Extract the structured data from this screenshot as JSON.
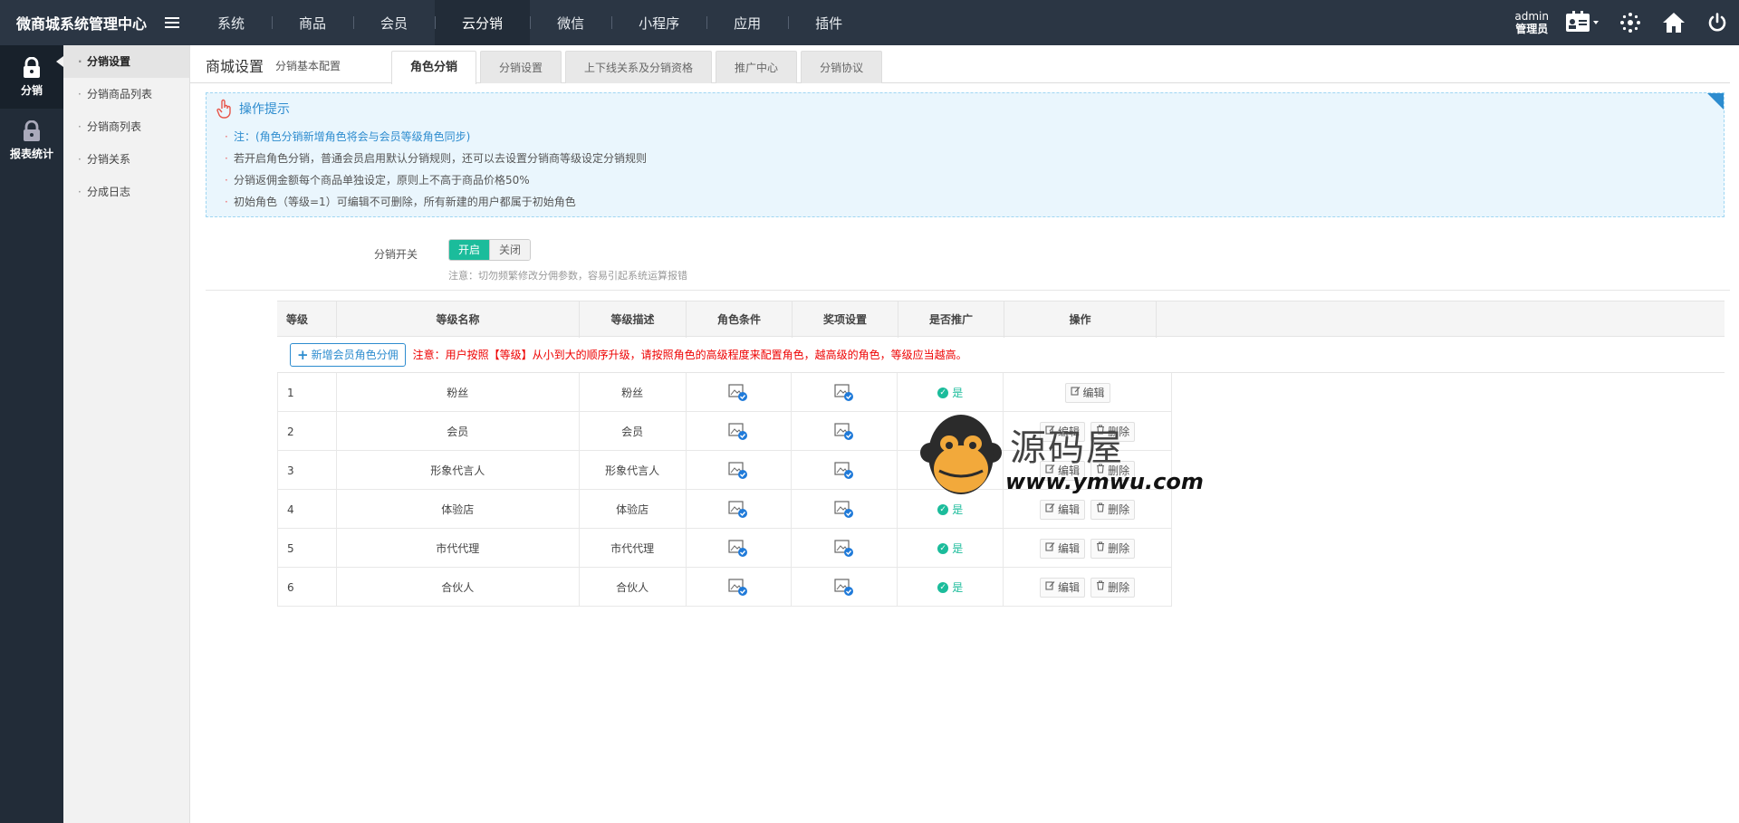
{
  "topbar": {
    "brand": "微商城系统管理中心",
    "nav": [
      "系统",
      "商品",
      "会员",
      "云分销",
      "微信",
      "小程序",
      "应用",
      "插件"
    ],
    "active_nav": 3,
    "admin_name": "admin",
    "admin_role": "管理员"
  },
  "sidebar": {
    "tiles": [
      {
        "label": "分销",
        "icon": "lock-icon",
        "active": true
      },
      {
        "label": "报表统计",
        "icon": "lock-icon",
        "active": false
      }
    ],
    "sub_items": [
      "分销设置",
      "分销商品列表",
      "分销商列表",
      "分销关系",
      "分成日志"
    ]
  },
  "header": {
    "title": "商城设置",
    "subtitle": "分销基本配置",
    "tabs": [
      "角色分销",
      "分销设置",
      "上下线关系及分销资格",
      "推广中心",
      "分销协议"
    ]
  },
  "tips": {
    "title": "操作提示",
    "items": [
      "注：(角色分销新增角色将会与会员等级角色同步)",
      "若开启角色分销，普通会员启用默认分销规则，还可以去设置分销商等级设定分销规则",
      "分销返佣金额每个商品单独设定，原则上不高于商品价格50%",
      "初始角色（等级=1）可编辑不可删除，所有新建的用户都属于初始角色"
    ]
  },
  "switch": {
    "label": "分销开关",
    "on": "开启",
    "off": "关闭",
    "note": "注意：切勿频繁修改分佣参数，容易引起系统运算报错"
  },
  "table": {
    "headers": [
      "等级",
      "等级名称",
      "等级描述",
      "角色条件",
      "奖项设置",
      "是否推广",
      "操作"
    ],
    "add_button": "新增会员角色分佣",
    "warning": "注意：用户按照【等级】从小到大的顺序升级，请按照角色的高级程度来配置角色，越高级的角色，等级应当越高。",
    "yes_label": "是",
    "edit_label": "编辑",
    "delete_label": "删除",
    "rows": [
      {
        "level": "1",
        "name": "粉丝",
        "desc": "粉丝"
      },
      {
        "level": "2",
        "name": "会员",
        "desc": "会员"
      },
      {
        "level": "3",
        "name": "形象代言人",
        "desc": "形象代言人"
      },
      {
        "level": "4",
        "name": "体验店",
        "desc": "体验店"
      },
      {
        "level": "5",
        "name": "市代代理",
        "desc": "市代代理"
      },
      {
        "level": "6",
        "name": "合伙人",
        "desc": "合伙人"
      }
    ]
  },
  "watermark": {
    "text": "源码屋",
    "url": "www.ymwu.com"
  },
  "colors": {
    "topbar": "#2b3644",
    "accent_green": "#1bbc9b",
    "accent_blue": "#2d8ccf",
    "warning_red": "#ee0000"
  }
}
